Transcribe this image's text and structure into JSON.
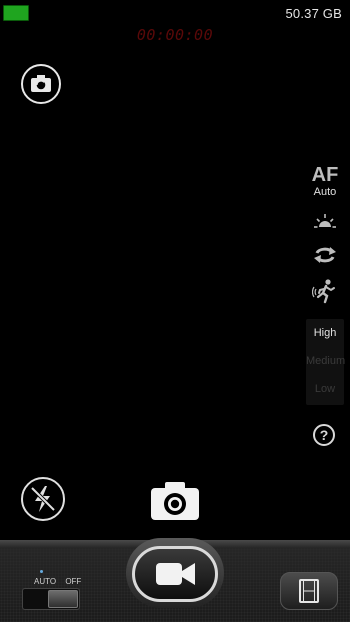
{
  "status": {
    "storage": "50.37 GB",
    "timer": "00:00:00",
    "battery_color": "#1fa51f"
  },
  "focus": {
    "label": "AF",
    "mode": "Auto"
  },
  "quality": {
    "options": [
      "High",
      "Medium",
      "Low"
    ],
    "selected": "High"
  },
  "help": {
    "label": "?"
  },
  "dock": {
    "mode_auto": "AUTO",
    "mode_off": "OFF"
  },
  "icons": {
    "flip": "flip-camera-icon",
    "brightness": "brightness-icon",
    "loop": "loop-icon",
    "stabilize": "stabilize-icon",
    "flash": "flash-off-icon",
    "camera": "camera-icon",
    "video": "video-camera-icon",
    "gallery": "film-icon"
  }
}
